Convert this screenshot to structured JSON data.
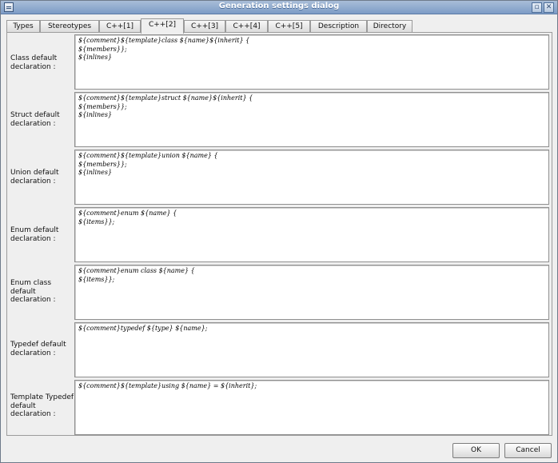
{
  "window": {
    "title": "Generation settings dialog"
  },
  "tabs": [
    {
      "label": "Types"
    },
    {
      "label": "Stereotypes"
    },
    {
      "label": "C++[1]"
    },
    {
      "label": "C++[2]"
    },
    {
      "label": "C++[3]"
    },
    {
      "label": "C++[4]"
    },
    {
      "label": "C++[5]"
    },
    {
      "label": "Description"
    },
    {
      "label": "Directory"
    }
  ],
  "active_tab": "C++[2]",
  "rows": [
    {
      "label": "Class default\ndeclaration :",
      "value": "${comment}${template}class ${name}${inherit} {\n${members}};\n${inlines}"
    },
    {
      "label": "Struct default\ndeclaration :",
      "value": "${comment}${template}struct ${name}${inherit} {\n${members}};\n${inlines}"
    },
    {
      "label": "Union default\ndeclaration :",
      "value": "${comment}${template}union ${name} {\n${members}};\n${inlines}"
    },
    {
      "label": "Enum default\ndeclaration :",
      "value": "${comment}enum ${name} {\n${items}};"
    },
    {
      "label": "Enum class\ndefault\ndeclaration :",
      "value": "${comment}enum class ${name} {\n${items}};"
    },
    {
      "label": "Typedef default\ndeclaration :",
      "value": "${comment}typedef ${type} ${name};"
    },
    {
      "label": "Template Typedef\ndefault\ndeclaration :",
      "value": "${comment}${template}using ${name} = ${inherit};"
    }
  ],
  "buttons": {
    "ok": "OK",
    "cancel": "Cancel"
  }
}
